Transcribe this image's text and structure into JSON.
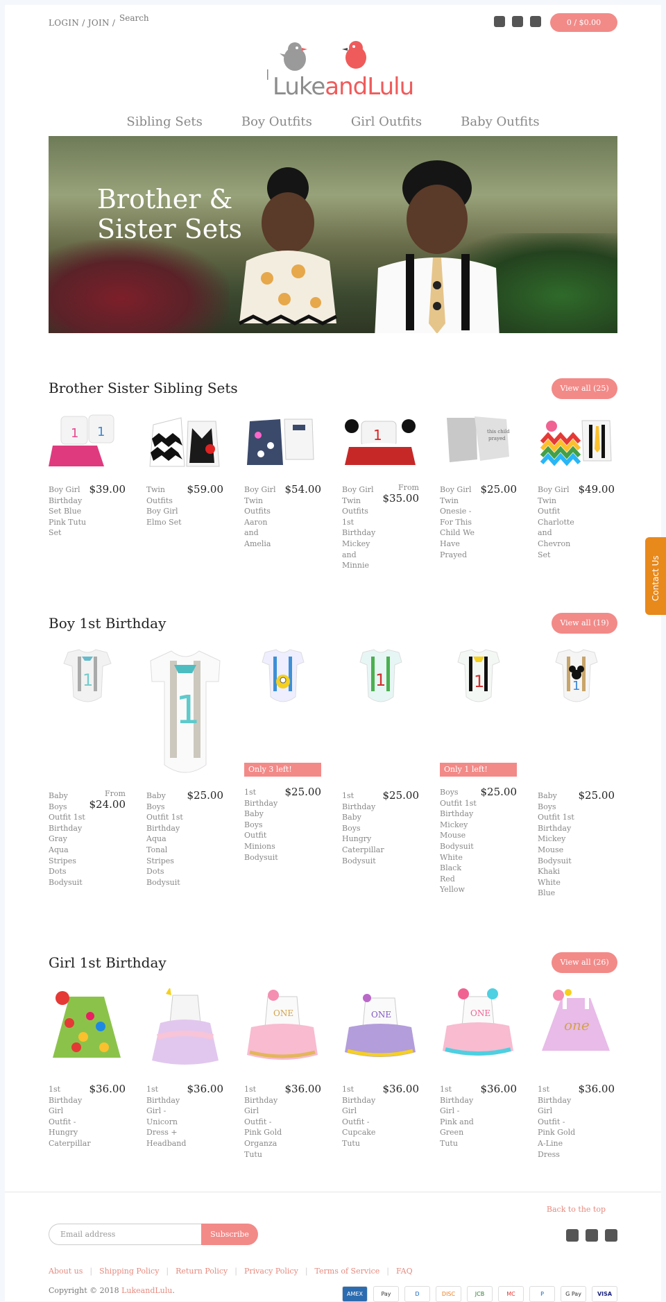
{
  "header": {
    "login_label": "LOGIN / JOIN /",
    "search_placeholder": "Search",
    "cart_label": "0 / $0.00",
    "social_icons": [
      "facebook-icon",
      "instagram-icon",
      "pinterest-icon"
    ]
  },
  "logo": {
    "part1": "Luke",
    "part2": "and",
    "part3": "Lulu"
  },
  "nav": [
    "Sibling Sets",
    "Boy Outfits",
    "Girl Outfits",
    "Baby Outfits"
  ],
  "hero": {
    "title_line1": "Brother &",
    "title_line2": "Sister Sets"
  },
  "sections": [
    {
      "title": "Brother Sister Sibling Sets",
      "view_all": "View all (25)",
      "products": [
        {
          "name": "Boy Girl Birthday Set Blue Pink Tutu Set",
          "price": "$39.00"
        },
        {
          "name": "Twin Outfits Boy Girl Elmo Set",
          "price": "$59.00"
        },
        {
          "name": "Boy Girl Twin Outfits Aaron and Amelia",
          "price": "$54.00"
        },
        {
          "name": "Boy Girl Twin Outfits 1st Birthday Mickey and Minnie",
          "price": "$35.00",
          "from": "From"
        },
        {
          "name": "Boy Girl Twin Onesie - For This Child We Have Prayed",
          "price": "$25.00"
        },
        {
          "name": "Boy Girl Twin Outfit Charlotte and Chevron Set",
          "price": "$49.00"
        }
      ]
    },
    {
      "title": "Boy 1st Birthday",
      "view_all": "View all (19)",
      "products": [
        {
          "name": "Baby Boys Outfit 1st Birthday Gray Aqua Stripes Dots Bodysuit",
          "price": "$24.00",
          "from": "From"
        },
        {
          "name": "Baby Boys Outfit 1st Birthday Aqua Tonal Stripes Dots Bodysuit",
          "price": "$25.00"
        },
        {
          "name": "1st Birthday Baby Boys Outfit Minions Bodysuit",
          "price": "$25.00",
          "badge": "Only 3 left!"
        },
        {
          "name": "1st Birthday Baby Boys Hungry Caterpillar Bodysuit",
          "price": "$25.00"
        },
        {
          "name": "Boys Outfit 1st Birthday Mickey Mouse Bodysuit White Black Red Yellow",
          "price": "$25.00",
          "badge": "Only 1 left!"
        },
        {
          "name": "Baby Boys Outfit 1st Birthday Mickey Mouse Bodysuit Khaki White Blue",
          "price": "$25.00"
        }
      ]
    },
    {
      "title": "Girl 1st Birthday",
      "view_all": "View all (26)",
      "products": [
        {
          "name": "1st Birthday Girl Outfit - Hungry Caterpillar",
          "price": "$36.00"
        },
        {
          "name": "1st Birthday Girl - Unicorn Dress + Headband",
          "price": "$36.00"
        },
        {
          "name": "1st Birthday Girl Outfit - Pink Gold Organza Tutu",
          "price": "$36.00"
        },
        {
          "name": "1st Birthday Girl Outfit - Cupcake Tutu",
          "price": "$36.00"
        },
        {
          "name": "1st Birthday Girl - Pink and Green Tutu",
          "price": "$36.00"
        },
        {
          "name": "1st Birthday Girl Outfit - Pink Gold A-Line Dress",
          "price": "$36.00"
        }
      ]
    }
  ],
  "footer": {
    "back_to_top": "Back to the top",
    "email_placeholder": "Email address",
    "subscribe_label": "Subscribe",
    "links": [
      "About us",
      "Shipping Policy",
      "Return Policy",
      "Privacy Policy",
      "Terms of Service",
      "FAQ"
    ],
    "copyright_prefix": "Copyright © 2018",
    "copyright_link": "LukeandLulu",
    "copyright_suffix": ".",
    "payment_icons": [
      "amex-icon",
      "apple-pay-icon",
      "diners-club-icon",
      "discover-icon",
      "jcb-icon",
      "mastercard-icon",
      "paypal-icon",
      "google-pay-icon",
      "visa-icon"
    ],
    "payment_labels": [
      "AMEX",
      "Pay",
      "D",
      "DISC",
      "JCB",
      "MC",
      "P",
      "G Pay",
      "VISA"
    ]
  },
  "contact_tab": {
    "label": "Contact Us"
  },
  "colors": {
    "accent": "#f28a88",
    "link": "#e58a7f",
    "contact": "#e8891c"
  }
}
